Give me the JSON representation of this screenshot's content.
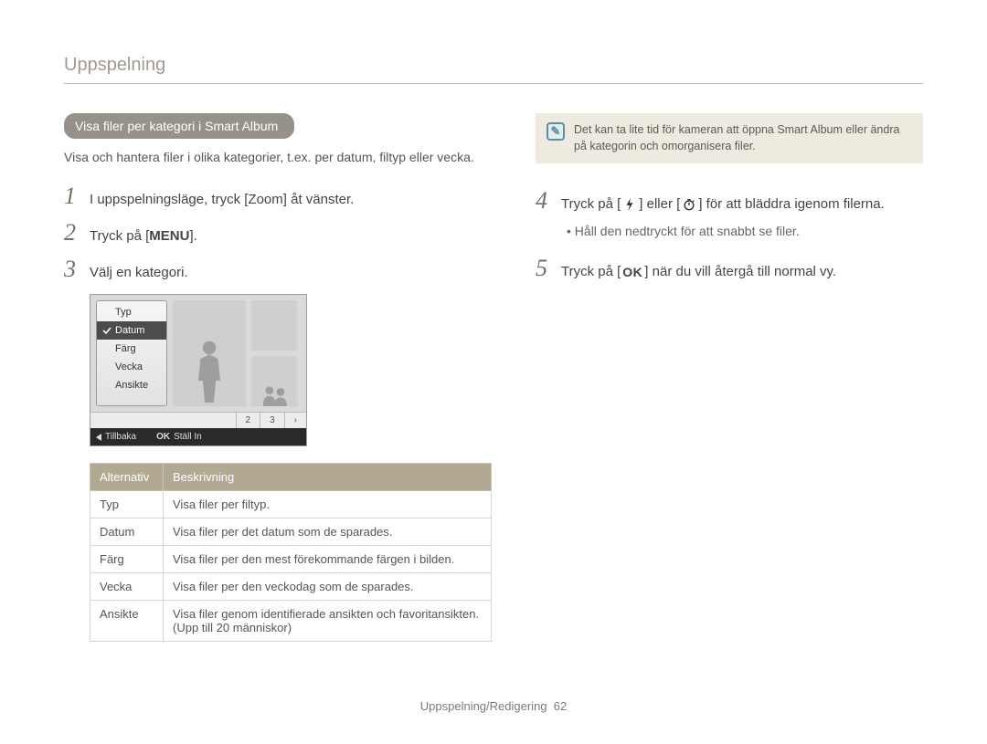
{
  "header": {
    "title": "Uppspelning"
  },
  "section": {
    "pill": "Visa ﬁler per kategori i Smart Album"
  },
  "intro": "Visa och hantera ﬁler i olika kategorier, t.ex. per datum, ﬁltyp eller vecka.",
  "stepsLeft": [
    {
      "n": "1",
      "text": "I uppspelningsläge, tryck [Zoom] åt vänster."
    },
    {
      "n": "2",
      "prefix": "Tryck på [",
      "btn": "MENU",
      "suffix": "]."
    },
    {
      "n": "3",
      "text": "Välj en kategori."
    }
  ],
  "screen": {
    "menu": [
      {
        "label": "Typ",
        "selected": false
      },
      {
        "label": "Datum",
        "selected": true
      },
      {
        "label": "Färg",
        "selected": false
      },
      {
        "label": "Vecka",
        "selected": false
      },
      {
        "label": "Ansikte",
        "selected": false
      }
    ],
    "pager": [
      "2",
      "3",
      "›"
    ],
    "footer": {
      "back": "Tillbaka",
      "set_btn": "OK",
      "set_label": "Ställ In"
    }
  },
  "table": {
    "headers": [
      "Alternativ",
      "Beskrivning"
    ],
    "rows": [
      [
        "Typ",
        "Visa ﬁler per ﬁltyp."
      ],
      [
        "Datum",
        "Visa ﬁler per det datum som de sparades."
      ],
      [
        "Färg",
        "Visa ﬁler per den mest förekommande färgen i bilden."
      ],
      [
        "Vecka",
        "Visa ﬁler per den veckodag som de sparades."
      ],
      [
        "Ansikte",
        "Visa ﬁler genom identiﬁerade ansikten och favoritansikten. (Upp till 20 människor)"
      ]
    ]
  },
  "note": "Det kan ta lite tid för kameran att öppna Smart Album eller ändra på kategorin och omorganisera ﬁler.",
  "stepsRight": {
    "step4": {
      "n": "4",
      "seg1": "Tryck på [",
      "seg2": "] eller [",
      "seg3": "] för att bläddra igenom ﬁlerna."
    },
    "bullet": "Håll den nedtryckt för att snabbt se ﬁler.",
    "step5": {
      "n": "5",
      "seg1": "Tryck på [",
      "btn": "OK",
      "seg2": "] när du vill återgå till normal vy."
    }
  },
  "footer": {
    "section": "Uppspelning/Redigering",
    "page": "62"
  }
}
